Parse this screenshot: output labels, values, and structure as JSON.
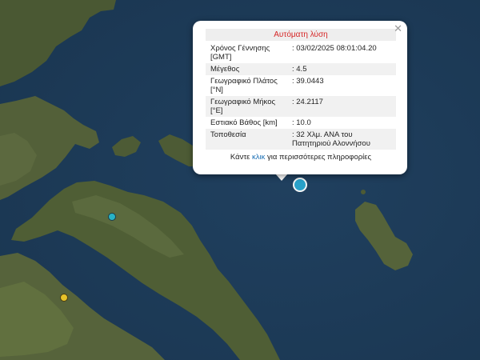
{
  "popup": {
    "title": "Αυτόματη λύση",
    "close_icon": "close-icon",
    "rows": [
      {
        "label": "Χρόνος Γέννησης [GMT]",
        "value": ": 03/02/2025 08:01:04.20"
      },
      {
        "label": "Μέγεθος",
        "value": ": 4.5"
      },
      {
        "label": "Γεωγραφικό Πλάτος [°N]",
        "value": ": 39.0443"
      },
      {
        "label": "Γεωγραφικό Μήκος [°E]",
        "value": ": 24.2117"
      },
      {
        "label": "Εστιακό Βάθος [km]",
        "value": ": 10.0"
      },
      {
        "label": "Τοποθεσία",
        "value": ": 32 Χλμ. ΑΝΑ του Πατητηριού Αλοννήσου"
      }
    ],
    "more_prefix": "Κάντε ",
    "more_link": "κλικ",
    "more_suffix": " για περισσότερες πληροφορίες"
  },
  "markers": [
    {
      "name": "selected-quake-marker",
      "color": "#2aa7cf"
    },
    {
      "name": "quake-marker-teal",
      "color": "#27b3c6"
    },
    {
      "name": "quake-marker-yellow",
      "color": "#e6c229"
    }
  ],
  "colors": {
    "sea": "#1f3d5c",
    "land": "#4c5a36",
    "title_text": "#d62626",
    "link": "#1a6fb5"
  }
}
